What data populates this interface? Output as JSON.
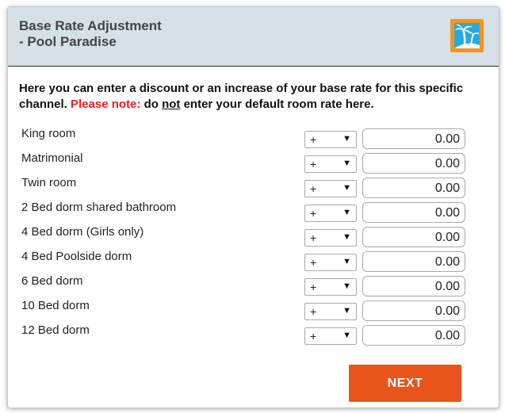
{
  "header": {
    "title": "Base Rate Adjustment\n- Pool Paradise",
    "logo_icon": "palm-tree-island-icon",
    "accent": "#29a9e0"
  },
  "intro": {
    "text_a": "Here you can enter a discount or an increase of your base rate for this specific channel. ",
    "note_label": "Please note:",
    "text_b": " do ",
    "emphasis": "not",
    "text_c": " enter your default room rate here."
  },
  "rooms": [
    {
      "label": "King room",
      "sign": "+",
      "value": "0.00"
    },
    {
      "label": "Matrimonial",
      "sign": "+",
      "value": "0.00"
    },
    {
      "label": "Twin room",
      "sign": "+",
      "value": "0.00"
    },
    {
      "label": "2 Bed dorm shared bathroom",
      "sign": "+",
      "value": "0.00"
    },
    {
      "label": "4 Bed dorm (Girls only)",
      "sign": "+",
      "value": "0.00"
    },
    {
      "label": "4 Bed Poolside dorm",
      "sign": "+",
      "value": "0.00"
    },
    {
      "label": "6 Bed dorm",
      "sign": "+",
      "value": "0.00"
    },
    {
      "label": "10 Bed dorm",
      "sign": "+",
      "value": "0.00"
    },
    {
      "label": "12 Bed dorm",
      "sign": "+",
      "value": "0.00"
    }
  ],
  "actions": {
    "next_label": "NEXT",
    "next_color": "#e8541c"
  },
  "colors": {
    "header_bg": "#d5e1e7",
    "note_red": "#e8221f"
  }
}
